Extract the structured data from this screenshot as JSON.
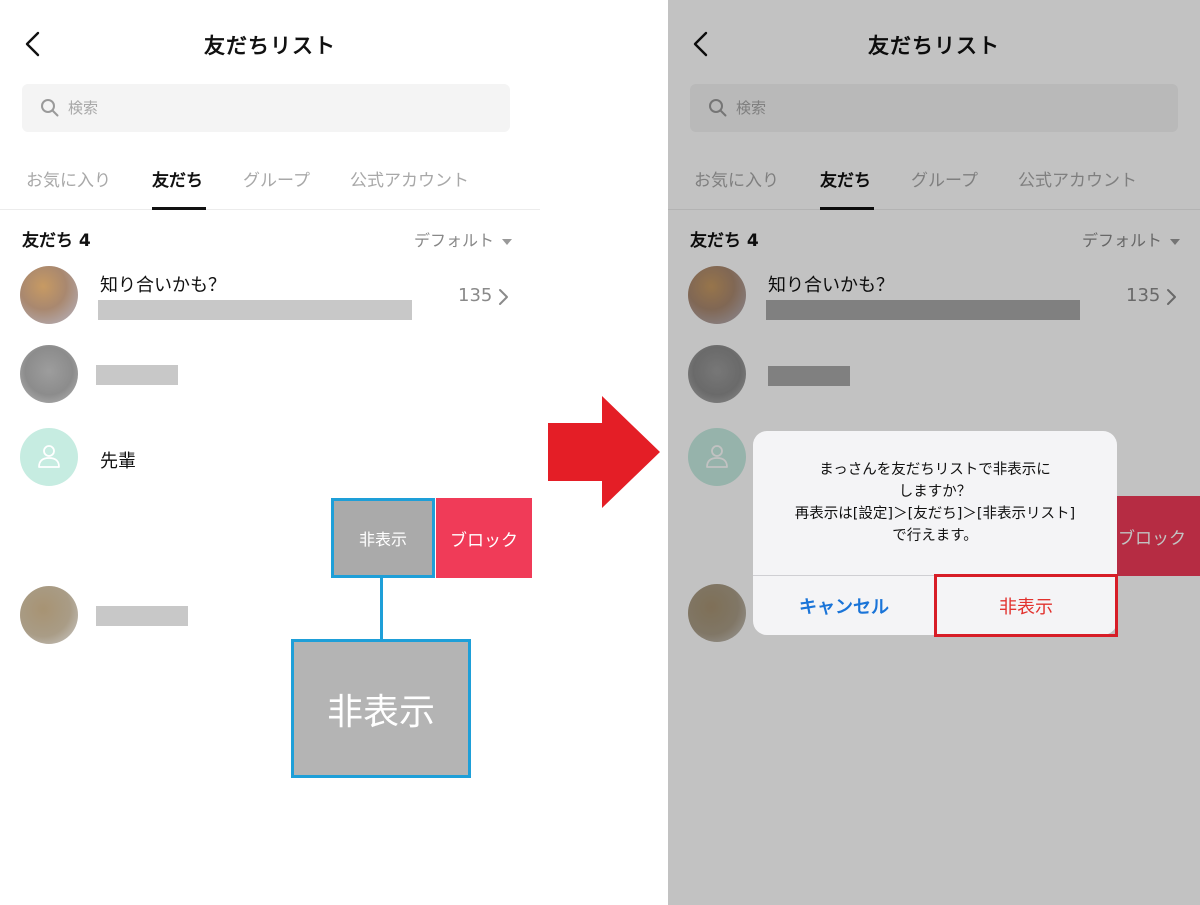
{
  "screens": [
    {
      "header": {
        "title": "友だちリスト"
      },
      "search": {
        "placeholder": "検索"
      },
      "tabs": [
        {
          "label": "お気に入り",
          "active": false
        },
        {
          "label": "友だち",
          "active": true
        },
        {
          "label": "グループ",
          "active": false
        },
        {
          "label": "公式アカウント",
          "active": false
        }
      ],
      "section": {
        "title": "友だち 4",
        "sort_label": "デフォルト"
      },
      "rows": [
        {
          "name": "知り合いかも？",
          "count": "135",
          "has_chevron": true
        },
        {
          "name": ""
        },
        {
          "name": "先輩"
        },
        {
          "name": ""
        }
      ],
      "swipe_actions": {
        "hide_label": "非表示",
        "block_label": "ブロック"
      },
      "callout": {
        "label": "非表示"
      }
    },
    {
      "header": {
        "title": "友だちリスト"
      },
      "search": {
        "placeholder": "検索"
      },
      "tabs": [
        {
          "label": "お気に入り",
          "active": false
        },
        {
          "label": "友だち",
          "active": true
        },
        {
          "label": "グループ",
          "active": false
        },
        {
          "label": "公式アカウント",
          "active": false
        }
      ],
      "section": {
        "title": "友だち 4",
        "sort_label": "デフォルト"
      },
      "rows": [
        {
          "name": "知り合いかも？",
          "count": "135",
          "has_chevron": true
        },
        {
          "name": ""
        },
        {
          "name": ""
        },
        {
          "name": ""
        }
      ],
      "swipe_actions": {
        "block_label": "ブロック"
      },
      "dialog": {
        "message_lines": [
          "まっさんを友だちリストで非表示に",
          "しますか？",
          "再表示は[設定]＞[友だち]＞[非表示リスト]",
          "で行えます。"
        ],
        "cancel_label": "キャンセル",
        "confirm_label": "非表示"
      }
    }
  ],
  "colors": {
    "highlight_blue": "#1e9fd8",
    "highlight_red": "#d71d27",
    "block_red": "#f03b58",
    "arrow_red": "#e41e26",
    "cancel_blue": "#1a74d8"
  }
}
